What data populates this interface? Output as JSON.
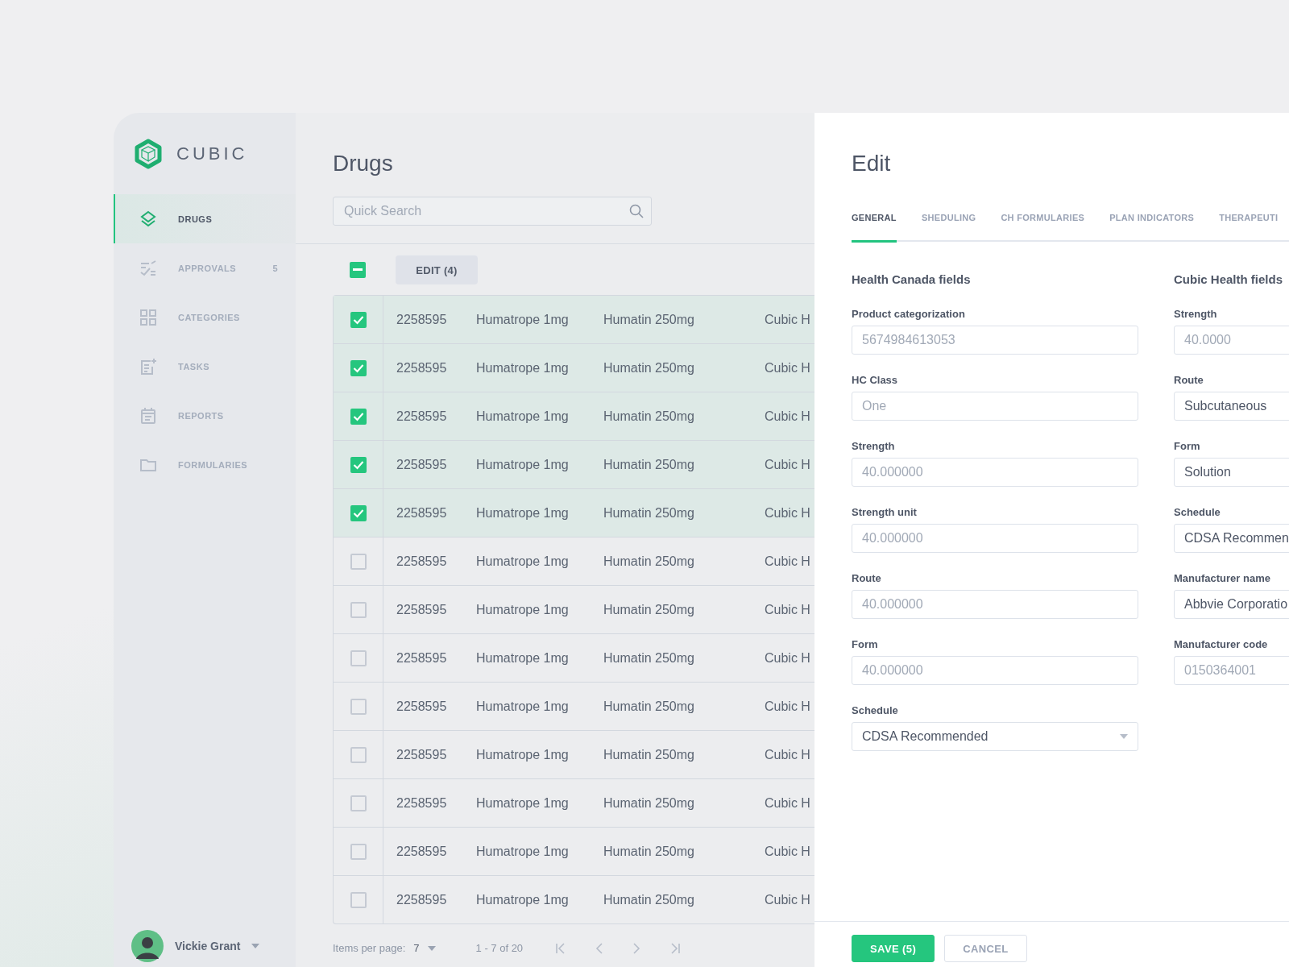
{
  "brand": {
    "name": "CUBIC"
  },
  "sidebar": {
    "items": [
      {
        "label": "DRUGS",
        "selected": true
      },
      {
        "label": "APPROVALS",
        "badge": "5",
        "selected": false
      },
      {
        "label": "CATEGORIES",
        "selected": false
      },
      {
        "label": "TASKS",
        "selected": false
      },
      {
        "label": "REPORTS",
        "selected": false
      },
      {
        "label": "FORMULARIES",
        "selected": false
      }
    ]
  },
  "user": {
    "name": "Vickie Grant"
  },
  "page": {
    "title": "Drugs",
    "search": {
      "placeholder": "Quick Search"
    }
  },
  "toolbar": {
    "indeterminate": true,
    "edit_button": "EDIT (4)"
  },
  "table": {
    "rows": [
      {
        "checked": true,
        "cells": [
          "2258595",
          "Humatrope 1mg",
          "Humatin 250mg",
          "Cubic H"
        ]
      },
      {
        "checked": true,
        "cells": [
          "2258595",
          "Humatrope 1mg",
          "Humatin 250mg",
          "Cubic H"
        ]
      },
      {
        "checked": true,
        "cells": [
          "2258595",
          "Humatrope 1mg",
          "Humatin 250mg",
          "Cubic H"
        ]
      },
      {
        "checked": true,
        "cells": [
          "2258595",
          "Humatrope 1mg",
          "Humatin 250mg",
          "Cubic H"
        ]
      },
      {
        "checked": true,
        "cells": [
          "2258595",
          "Humatrope 1mg",
          "Humatin 250mg",
          "Cubic H"
        ]
      },
      {
        "checked": false,
        "cells": [
          "2258595",
          "Humatrope 1mg",
          "Humatin 250mg",
          "Cubic H"
        ]
      },
      {
        "checked": false,
        "cells": [
          "2258595",
          "Humatrope 1mg",
          "Humatin 250mg",
          "Cubic H"
        ]
      },
      {
        "checked": false,
        "cells": [
          "2258595",
          "Humatrope 1mg",
          "Humatin 250mg",
          "Cubic H"
        ]
      },
      {
        "checked": false,
        "cells": [
          "2258595",
          "Humatrope 1mg",
          "Humatin 250mg",
          "Cubic H"
        ]
      },
      {
        "checked": false,
        "cells": [
          "2258595",
          "Humatrope 1mg",
          "Humatin 250mg",
          "Cubic H"
        ]
      },
      {
        "checked": false,
        "cells": [
          "2258595",
          "Humatrope 1mg",
          "Humatin 250mg",
          "Cubic H"
        ]
      },
      {
        "checked": false,
        "cells": [
          "2258595",
          "Humatrope 1mg",
          "Humatin 250mg",
          "Cubic H"
        ]
      },
      {
        "checked": false,
        "cells": [
          "2258595",
          "Humatrope 1mg",
          "Humatin 250mg",
          "Cubic H"
        ]
      }
    ]
  },
  "pagination": {
    "label": "Items per page:",
    "per_page": "7",
    "range": "1 - 7 of 20"
  },
  "edit_panel": {
    "title": "Edit",
    "tabs": [
      {
        "label": "GENERAL",
        "selected": true
      },
      {
        "label": "SHEDULING",
        "selected": false
      },
      {
        "label": "CH FORMULARIES",
        "selected": false
      },
      {
        "label": "PLAN INDICATORS",
        "selected": false
      },
      {
        "label": "THERAPEUTI",
        "selected": false
      }
    ],
    "sections": [
      {
        "title": "Health Canada fields",
        "fields": [
          {
            "label": "Product categorization",
            "value": "5674984613053",
            "kind": "input",
            "disabled": true
          },
          {
            "label": "HC Class",
            "value": "One",
            "kind": "input",
            "disabled": true
          },
          {
            "label": "Strength",
            "value": "40.000000",
            "kind": "input",
            "disabled": true
          },
          {
            "label": "Strength unit",
            "value": "40.000000",
            "kind": "input",
            "disabled": true
          },
          {
            "label": "Route",
            "value": "40.000000",
            "kind": "input",
            "disabled": true
          },
          {
            "label": "Form",
            "value": "40.000000",
            "kind": "input",
            "disabled": true
          },
          {
            "label": "Schedule",
            "value": "CDSA Recommended",
            "kind": "select",
            "disabled": false
          }
        ]
      },
      {
        "title": "Cubic Health fields",
        "fields": [
          {
            "label": "Strength",
            "value": "40.0000",
            "kind": "input",
            "disabled": true
          },
          {
            "label": "Route",
            "value": "Subcutaneous",
            "kind": "input",
            "disabled": false
          },
          {
            "label": "Form",
            "value": "Solution",
            "kind": "input",
            "disabled": false
          },
          {
            "label": "Schedule",
            "value": "CDSA Recommen",
            "kind": "input",
            "disabled": false
          },
          {
            "label": "Manufacturer name",
            "value": "Abbvie Corporatio",
            "kind": "input",
            "disabled": false
          },
          {
            "label": "Manufacturer code",
            "value": "0150364001",
            "kind": "input",
            "disabled": true
          }
        ]
      }
    ],
    "buttons": [
      {
        "label": "SAVE (5)",
        "kind": "primary"
      },
      {
        "label": "CANCEL",
        "kind": "secondary"
      }
    ]
  }
}
